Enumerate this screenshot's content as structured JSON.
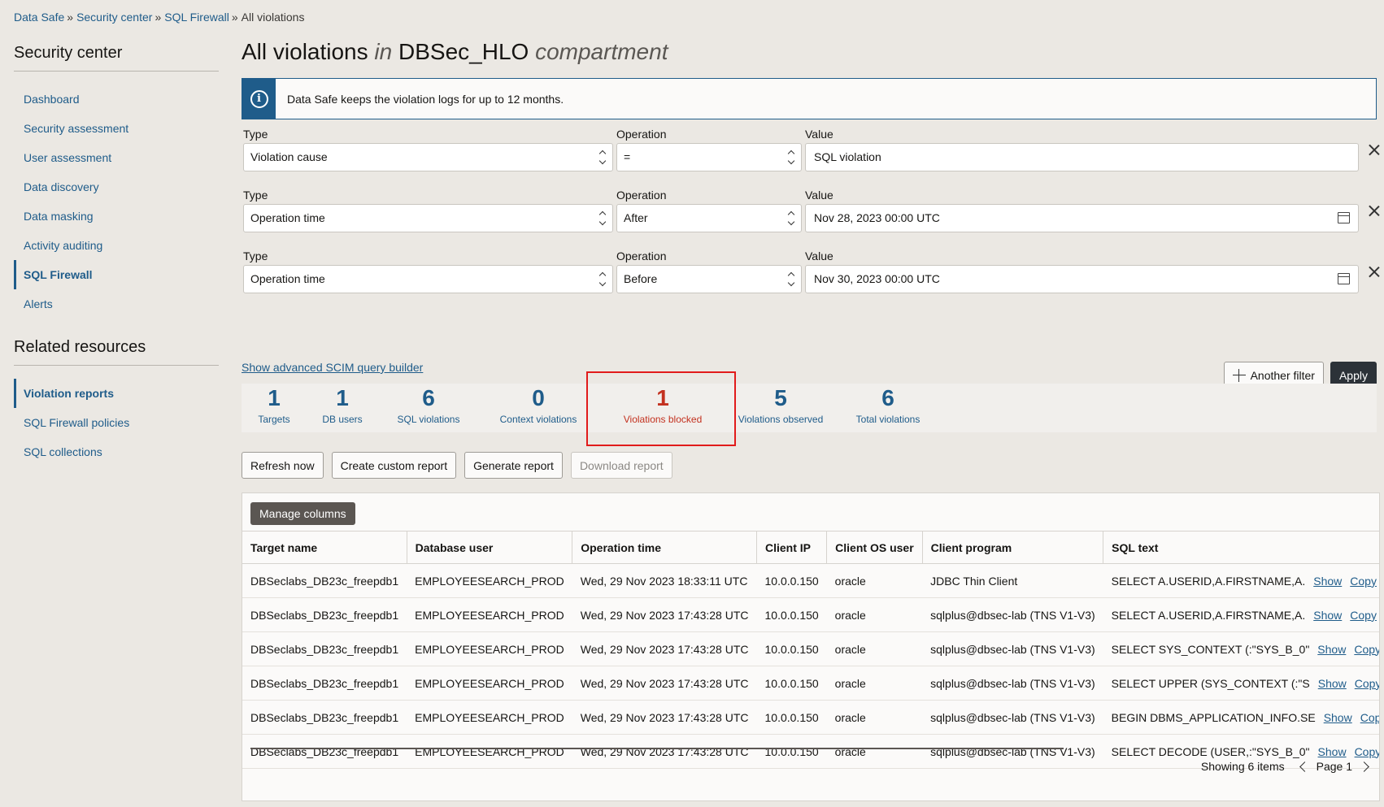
{
  "breadcrumb": {
    "items": [
      "Data Safe",
      "Security center",
      "SQL Firewall"
    ],
    "current": "All violations",
    "separator": "»"
  },
  "leftnav": {
    "heading": "Security center",
    "items": [
      "Dashboard",
      "Security assessment",
      "User assessment",
      "Data discovery",
      "Data masking",
      "Activity auditing",
      "SQL Firewall",
      "Alerts"
    ],
    "active": "SQL Firewall",
    "related_heading": "Related resources",
    "related_items": [
      "Violation reports",
      "SQL Firewall policies",
      "SQL collections"
    ],
    "related_active": "Violation reports"
  },
  "page": {
    "title_main": "All violations",
    "title_in": "in",
    "title_compartment": "DBSec_HLO",
    "title_suffix": "compartment"
  },
  "info_banner": {
    "icon": "info-icon",
    "text": "Data Safe keeps the violation logs for up to 12 months."
  },
  "filters": {
    "type_label": "Type",
    "operation_label": "Operation",
    "value_label": "Value",
    "rows": [
      {
        "type": "Violation cause",
        "operation": "=",
        "value": "SQL violation",
        "is_date": false
      },
      {
        "type": "Operation time",
        "operation": "After",
        "value": "Nov 28, 2023 00:00 UTC",
        "is_date": true
      },
      {
        "type": "Operation time",
        "operation": "Before",
        "value": "Nov 30, 2023 00:00 UTC",
        "is_date": true
      }
    ],
    "another_filter_label": "Another filter",
    "apply_label": "Apply",
    "scim_link": "Show advanced SCIM query builder"
  },
  "metrics": [
    {
      "value": "1",
      "label": "Targets"
    },
    {
      "value": "1",
      "label": "DB users"
    },
    {
      "value": "6",
      "label": "SQL violations"
    },
    {
      "value": "0",
      "label": "Context violations"
    },
    {
      "value": "1",
      "label": "Violations blocked"
    },
    {
      "value": "5",
      "label": "Violations observed"
    },
    {
      "value": "6",
      "label": "Total violations"
    }
  ],
  "actions": {
    "refresh": "Refresh now",
    "create_report": "Create custom report",
    "generate_report": "Generate report",
    "download_report": "Download report"
  },
  "table": {
    "manage_columns": "Manage columns",
    "columns": [
      "Target name",
      "Database user",
      "Operation time",
      "Client IP",
      "Client OS user",
      "Client program",
      "SQL text"
    ],
    "row_links": [
      "Show",
      "Copy"
    ],
    "rows": [
      [
        "DBSeclabs_DB23c_freepdb1",
        "EMPLOYEESEARCH_PROD",
        "Wed, 29 Nov 2023 18:33:11 UTC",
        "10.0.0.150",
        "oracle",
        "JDBC Thin Client",
        "SELECT A.USERID,A.FIRSTNAME,A."
      ],
      [
        "DBSeclabs_DB23c_freepdb1",
        "EMPLOYEESEARCH_PROD",
        "Wed, 29 Nov 2023 17:43:28 UTC",
        "10.0.0.150",
        "oracle",
        "sqlplus@dbsec-lab (TNS V1-V3)",
        "SELECT A.USERID,A.FIRSTNAME,A."
      ],
      [
        "DBSeclabs_DB23c_freepdb1",
        "EMPLOYEESEARCH_PROD",
        "Wed, 29 Nov 2023 17:43:28 UTC",
        "10.0.0.150",
        "oracle",
        "sqlplus@dbsec-lab (TNS V1-V3)",
        "SELECT SYS_CONTEXT (:\"SYS_B_0\""
      ],
      [
        "DBSeclabs_DB23c_freepdb1",
        "EMPLOYEESEARCH_PROD",
        "Wed, 29 Nov 2023 17:43:28 UTC",
        "10.0.0.150",
        "oracle",
        "sqlplus@dbsec-lab (TNS V1-V3)",
        "SELECT UPPER (SYS_CONTEXT (:\"S"
      ],
      [
        "DBSeclabs_DB23c_freepdb1",
        "EMPLOYEESEARCH_PROD",
        "Wed, 29 Nov 2023 17:43:28 UTC",
        "10.0.0.150",
        "oracle",
        "sqlplus@dbsec-lab (TNS V1-V3)",
        "BEGIN DBMS_APPLICATION_INFO.SE"
      ],
      [
        "DBSeclabs_DB23c_freepdb1",
        "EMPLOYEESEARCH_PROD",
        "Wed, 29 Nov 2023 17:43:28 UTC",
        "10.0.0.150",
        "oracle",
        "sqlplus@dbsec-lab (TNS V1-V3)",
        "SELECT DECODE (USER,:\"SYS_B_0\""
      ]
    ],
    "showing": "Showing 6 items",
    "page_label": "Page 1"
  },
  "colors": {
    "link": "#1f5c8a",
    "highlight_border": "#e11b1b",
    "blocked": "#c3311f",
    "primary_button": "#2c3238"
  }
}
